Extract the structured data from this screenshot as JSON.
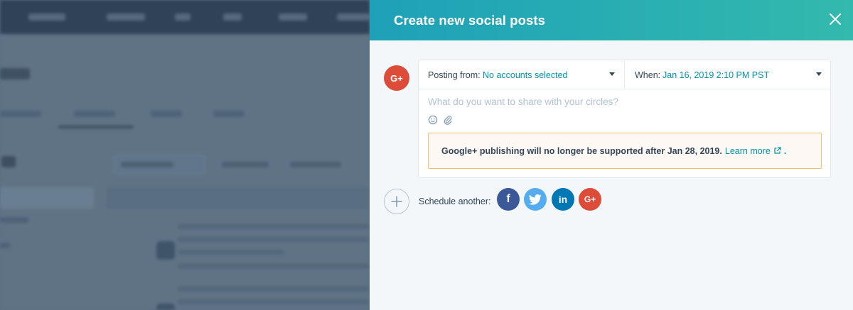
{
  "panel": {
    "title": "Create new social posts",
    "close_icon": "close-icon"
  },
  "post": {
    "network_avatar_label": "G+",
    "posting_from_label": "Posting from:",
    "posting_from_value": "No accounts selected",
    "when_label": "When:",
    "when_value": "Jan 16, 2019 2:10 PM PST",
    "compose_placeholder": "What do you want to share with your circles?",
    "tools": [
      "emoji-icon",
      "attachment-icon"
    ]
  },
  "notice": {
    "text": "Google+ publishing will no longer be supported after Jan 28, 2019.",
    "link_text": "Learn more",
    "trailing": "."
  },
  "schedule": {
    "label": "Schedule another:",
    "networks": [
      "f",
      "twitter",
      "in",
      "G+"
    ]
  },
  "colors": {
    "header_gradient_start": "#1ea1b8",
    "header_gradient_end": "#33b9ad",
    "link": "#0091ae",
    "text": "#33475b",
    "notice_border": "#f5c26b",
    "facebook": "#3b5998",
    "twitter": "#55acee",
    "linkedin": "#0077b5",
    "googleplus": "#dd4b39"
  }
}
